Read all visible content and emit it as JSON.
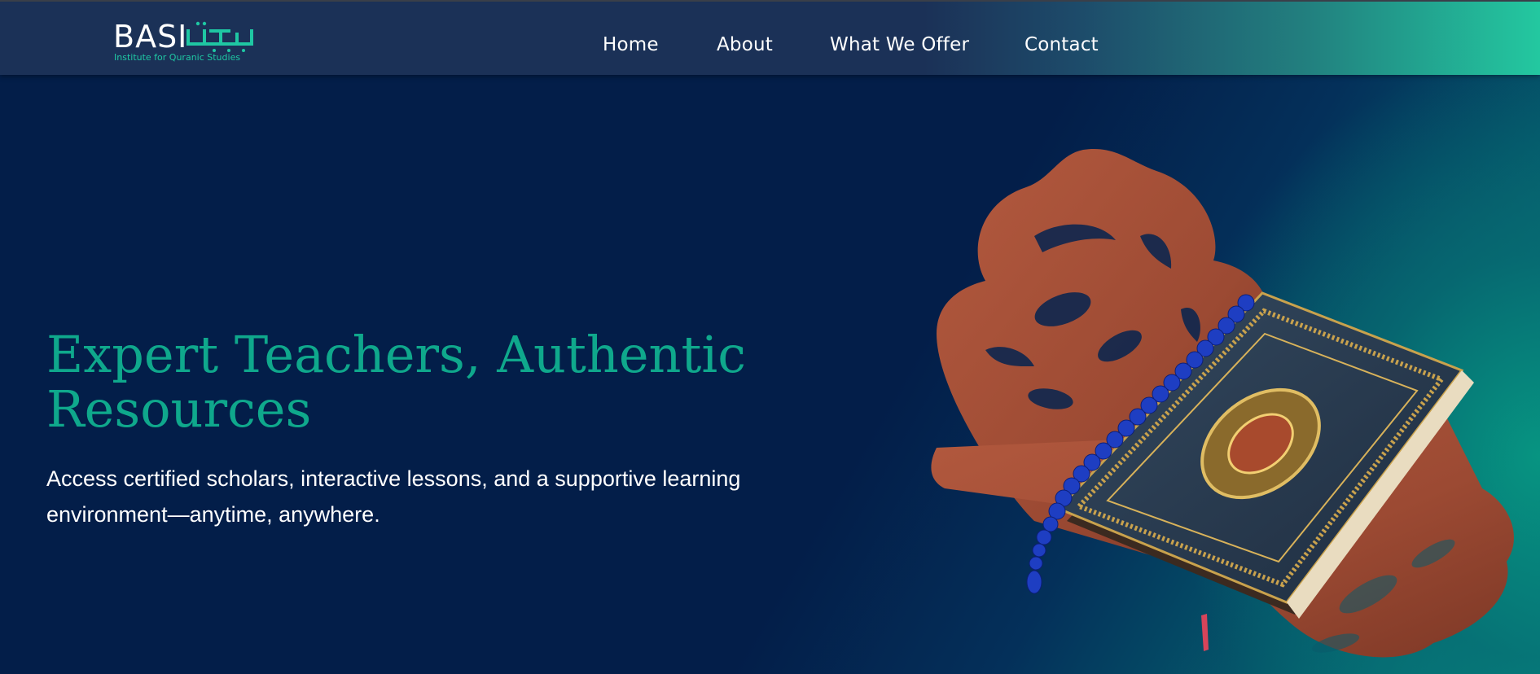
{
  "brand": {
    "name": "BASI",
    "tagline": "Institute for Quranic Studies",
    "accent_color": "#1fc7a3"
  },
  "nav": {
    "items": [
      {
        "label": "Home"
      },
      {
        "label": "About"
      },
      {
        "label": "What We Offer"
      },
      {
        "label": "Contact"
      }
    ]
  },
  "hero": {
    "title": "Expert Teachers, Authentic Resources",
    "subtitle": "Access certified scholars, interactive lessons, and a supportive learning environment—anytime, anywhere.",
    "title_color": "#0fa88c",
    "background_color": "#031e49"
  },
  "illustration": {
    "icon": "quran-on-stand-icon",
    "beads_color": "#1d3cbf",
    "stand_color": "#a4523c",
    "book_color": "#2a3d52"
  }
}
